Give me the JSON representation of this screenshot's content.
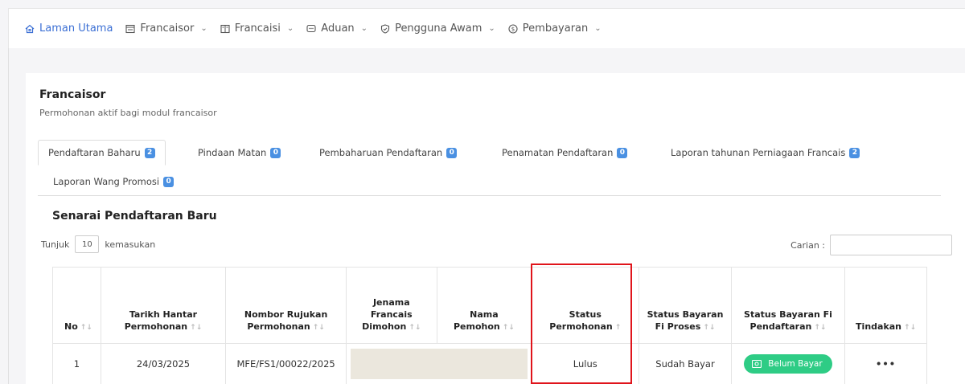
{
  "nav": [
    {
      "label": "Laman Utama",
      "icon": "home-icon",
      "dropdown": false
    },
    {
      "label": "Francaisor",
      "icon": "list-icon",
      "dropdown": true
    },
    {
      "label": "Francaisi",
      "icon": "book-icon",
      "dropdown": true
    },
    {
      "label": "Aduan",
      "icon": "chat-icon",
      "dropdown": true
    },
    {
      "label": "Pengguna Awam",
      "icon": "shield-icon",
      "dropdown": true
    },
    {
      "label": "Pembayaran",
      "icon": "coin-icon",
      "dropdown": true
    }
  ],
  "card": {
    "title": "Francaisor",
    "subtitle": "Permohonan aktif bagi modul francaisor"
  },
  "tabs": [
    {
      "label": "Pendaftaran Baharu",
      "count": "2"
    },
    {
      "label": "Pindaan Matan",
      "count": "0"
    },
    {
      "label": "Pembaharuan Pendaftaran",
      "count": "0"
    },
    {
      "label": "Penamatan Pendaftaran",
      "count": "0"
    },
    {
      "label": "Laporan tahunan Perniagaan Francais",
      "count": "2"
    },
    {
      "label": "Laporan Wang Promosi",
      "count": "0"
    }
  ],
  "section_title": "Senarai Pendaftaran Baru",
  "length": {
    "prefix": "Tunjuk",
    "value": "10",
    "suffix": "kemasukan"
  },
  "search": {
    "label": "Carian :"
  },
  "table": {
    "headers": [
      "No",
      "Tarikh Hantar Permohonan",
      "Nombor Rujukan Permohonan",
      "Jenama Francais Dimohon",
      "Nama Pemohon",
      "Status Permohonan",
      "Status Bayaran Fi Proses",
      "Status Bayaran Fi Pendaftaran",
      "Tindakan"
    ],
    "rows": [
      {
        "no": "1",
        "date": "24/03/2025",
        "ref": "MFE/FS1/00022/2025",
        "status": "Lulus",
        "fee_process": "Sudah Bayar",
        "fee_reg": "Belum Bayar",
        "action": "•••"
      }
    ]
  },
  "colors": {
    "accent": "#3b6fd4",
    "badge": "#4a90e2",
    "pill": "#2ecc85",
    "highlight": "#e0141b"
  }
}
